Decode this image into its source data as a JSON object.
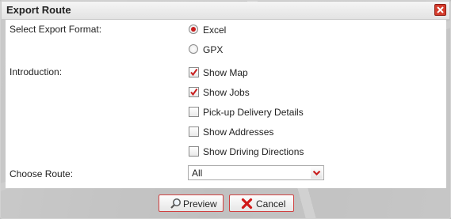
{
  "dialog": {
    "title": "Export Route",
    "close_icon": "close-icon",
    "accent_color": "#c81e1e"
  },
  "format": {
    "label": "Select Export Format:",
    "options": [
      {
        "label": "Excel",
        "selected": true
      },
      {
        "label": "GPX",
        "selected": false
      }
    ]
  },
  "introduction": {
    "label": "Introduction:",
    "options": [
      {
        "label": "Show Map",
        "checked": true
      },
      {
        "label": "Show Jobs",
        "checked": true
      },
      {
        "label": "Pick-up Delivery Details",
        "checked": false
      },
      {
        "label": "Show Addresses",
        "checked": false
      },
      {
        "label": "Show Driving Directions",
        "checked": false
      }
    ]
  },
  "route": {
    "label": "Choose Route:",
    "selected": "All"
  },
  "buttons": {
    "preview": "Preview",
    "cancel": "Cancel"
  }
}
